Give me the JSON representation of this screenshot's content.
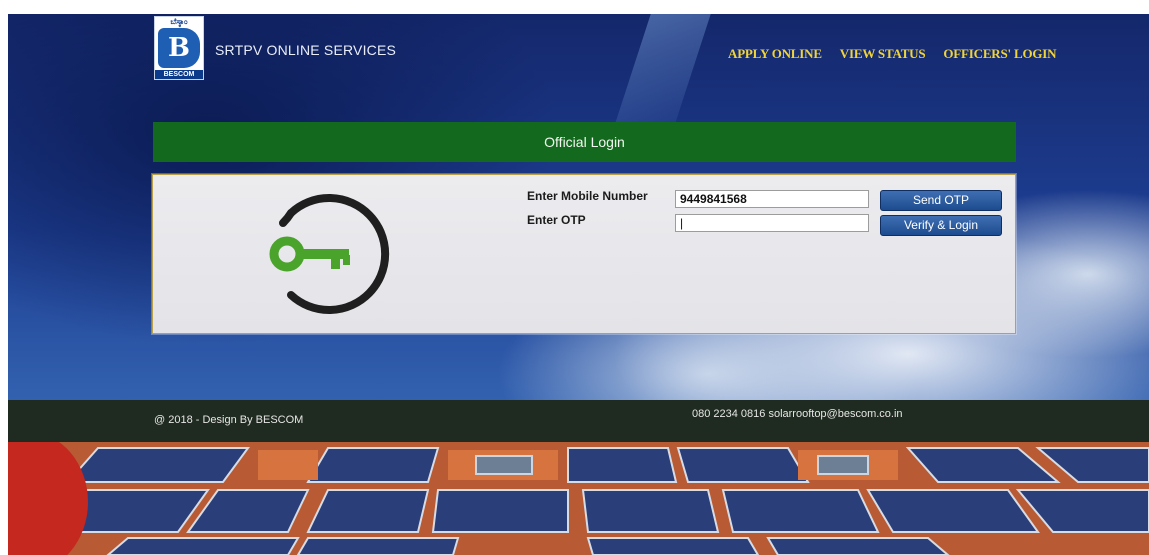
{
  "header": {
    "logo_top_text": "ಬೆಸ್ಕಾಂ",
    "logo_bottom_text": "BESCOM",
    "brand": "SRTPV ONLINE SERVICES",
    "nav": [
      {
        "label": "APPLY ONLINE"
      },
      {
        "label": "VIEW STATUS"
      },
      {
        "label": "OFFICERS' LOGIN"
      }
    ]
  },
  "login": {
    "title": "Official Login",
    "mobile_label": "Enter Mobile Number",
    "mobile_value": "9449841568",
    "otp_label": "Enter OTP",
    "otp_value": "|",
    "send_otp_label": "Send OTP",
    "verify_label": "Verify & Login"
  },
  "footer": {
    "copyright": "@ 2018 - Design By  BESCOM",
    "contact": "080 2234 0816   solarrooftop@bescom.co.in"
  },
  "colors": {
    "accent_green": "#136a1e",
    "nav_yellow": "#f0d43a",
    "button_blue": "#1d4b8f",
    "key_green": "#4aa32a"
  }
}
